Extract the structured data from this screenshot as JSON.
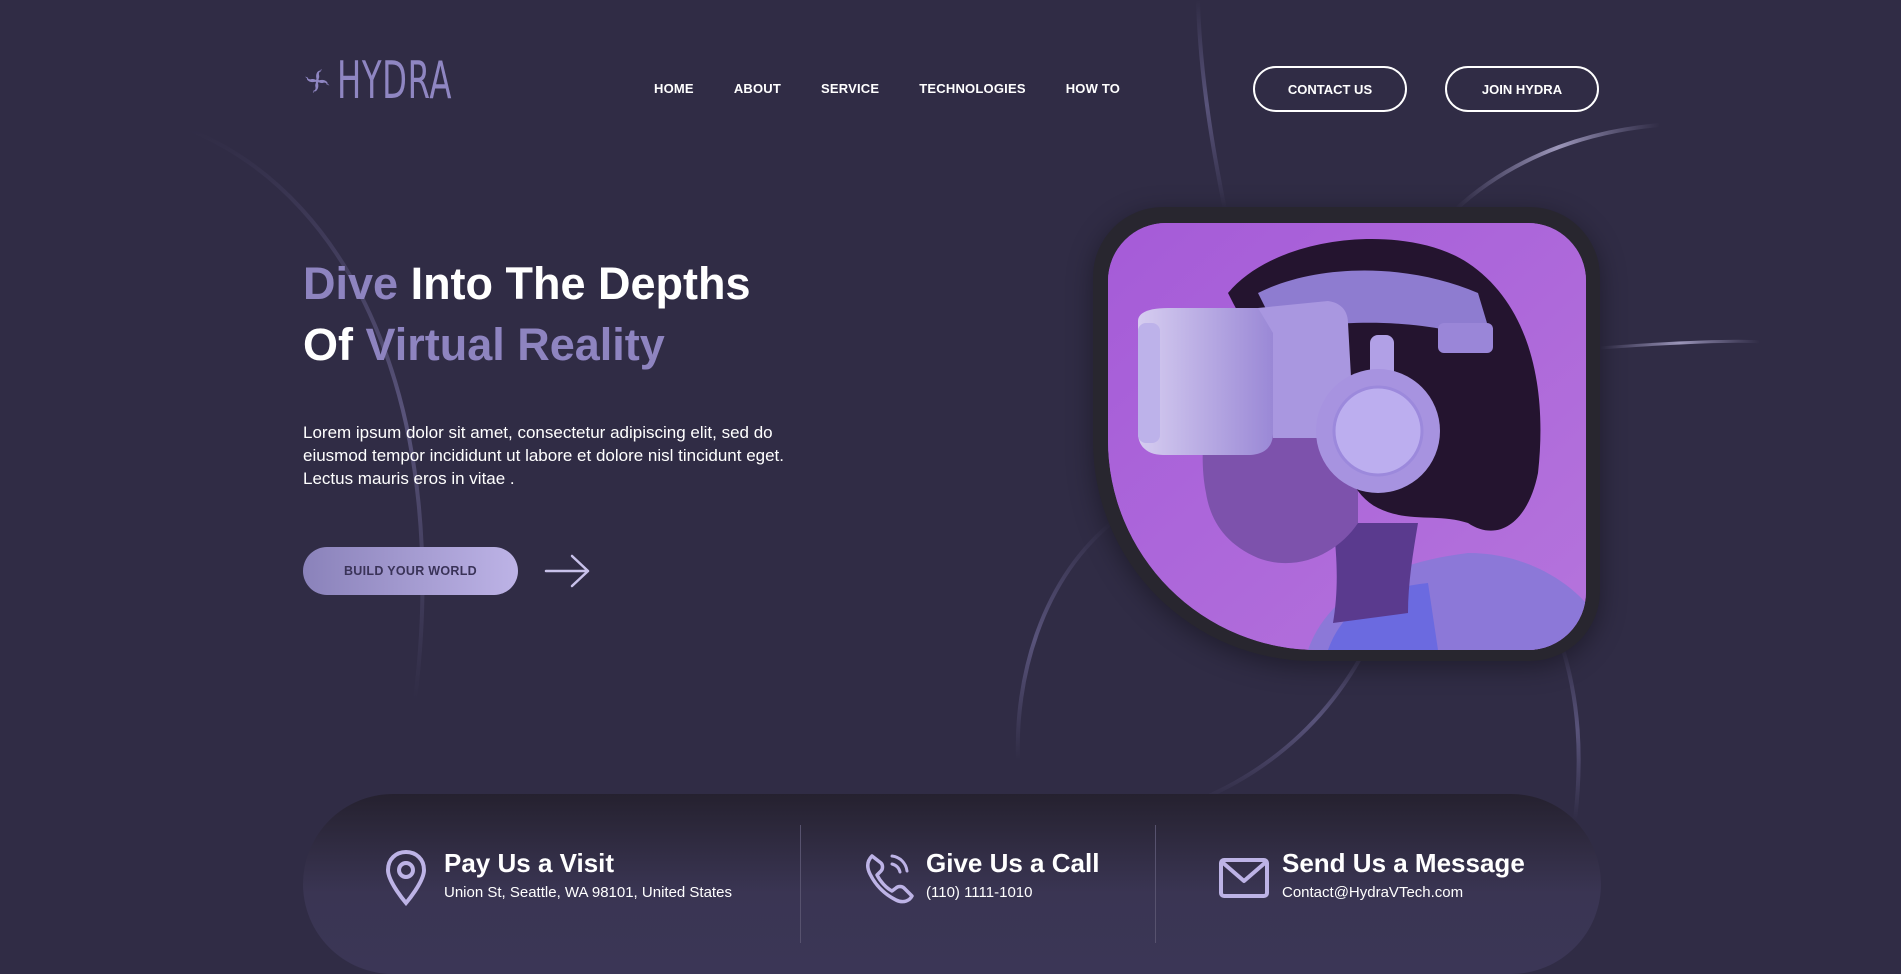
{
  "brand": {
    "name": "HYDRA",
    "logo_icon": "hydra-swirl-logo",
    "accent_color": "#8e84c0",
    "background_color": "#302c45"
  },
  "nav": {
    "items": [
      "HOME",
      "ABOUT",
      "SERVICE",
      "TECHNOLOGIES",
      "HOW TO"
    ]
  },
  "header_buttons": {
    "contact": "CONTACT US",
    "join": "JOIN HYDRA"
  },
  "hero": {
    "title_accent_1": "Dive",
    "title_rest_1": " Into The Depths",
    "title_start_2": "Of ",
    "title_accent_2": "Virtual Reality",
    "description": "Lorem ipsum dolor sit amet, consectetur adipiscing elit, sed do eiusmod tempor incididunt ut labore et dolore nisl tincidunt eget. Lectus mauris eros in vitae .",
    "cta": "BUILD YOUR WORLD",
    "cta_arrow_icon": "arrow-right-icon",
    "image": "person-wearing-vr-headset"
  },
  "contact": [
    {
      "icon": "location-pin-icon",
      "title": "Pay Us a Visit",
      "detail": "Union St, Seattle, WA 98101, United States"
    },
    {
      "icon": "phone-icon",
      "title": "Give Us a Call",
      "detail": "(110) 1111-1010"
    },
    {
      "icon": "mail-icon",
      "title": "Send Us a Message",
      "detail": "Contact@HydraVTech.com"
    }
  ]
}
